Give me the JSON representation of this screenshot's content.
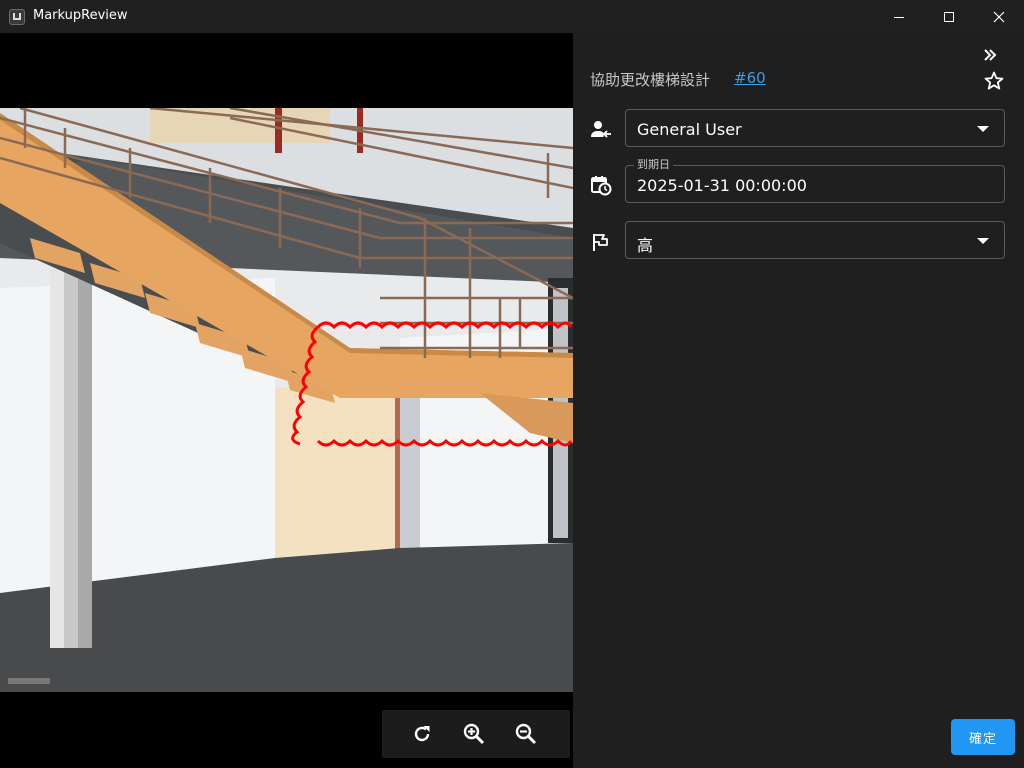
{
  "window": {
    "title": "MarkupReview",
    "icon": "app-logo-icon",
    "controls": [
      "minimize-icon",
      "maximize-icon",
      "close-icon"
    ]
  },
  "viewer": {
    "image": "staircase-render-with-revision-cloud",
    "toolbar": [
      "rotate-icon",
      "zoom-in-icon",
      "zoom-out-icon"
    ]
  },
  "panel": {
    "collapse_icon": "double-chevron-right-icon",
    "favorite_icon": "star-outline-icon",
    "issue_title": "協助更改樓梯設計",
    "issue_number": "#60",
    "assignee": {
      "icon": "person-assign-icon",
      "value": "General User"
    },
    "due_date": {
      "icon": "calendar-clock-icon",
      "label": "到期日",
      "value": "2025-01-31 00:00:00"
    },
    "priority": {
      "icon": "flag-icon",
      "value": "高"
    },
    "confirm_label": "確定"
  },
  "colors": {
    "accent": "#2196f3",
    "link": "#3d9be9",
    "markup_cloud": "#ff0000",
    "background": "#1f1f1f"
  }
}
